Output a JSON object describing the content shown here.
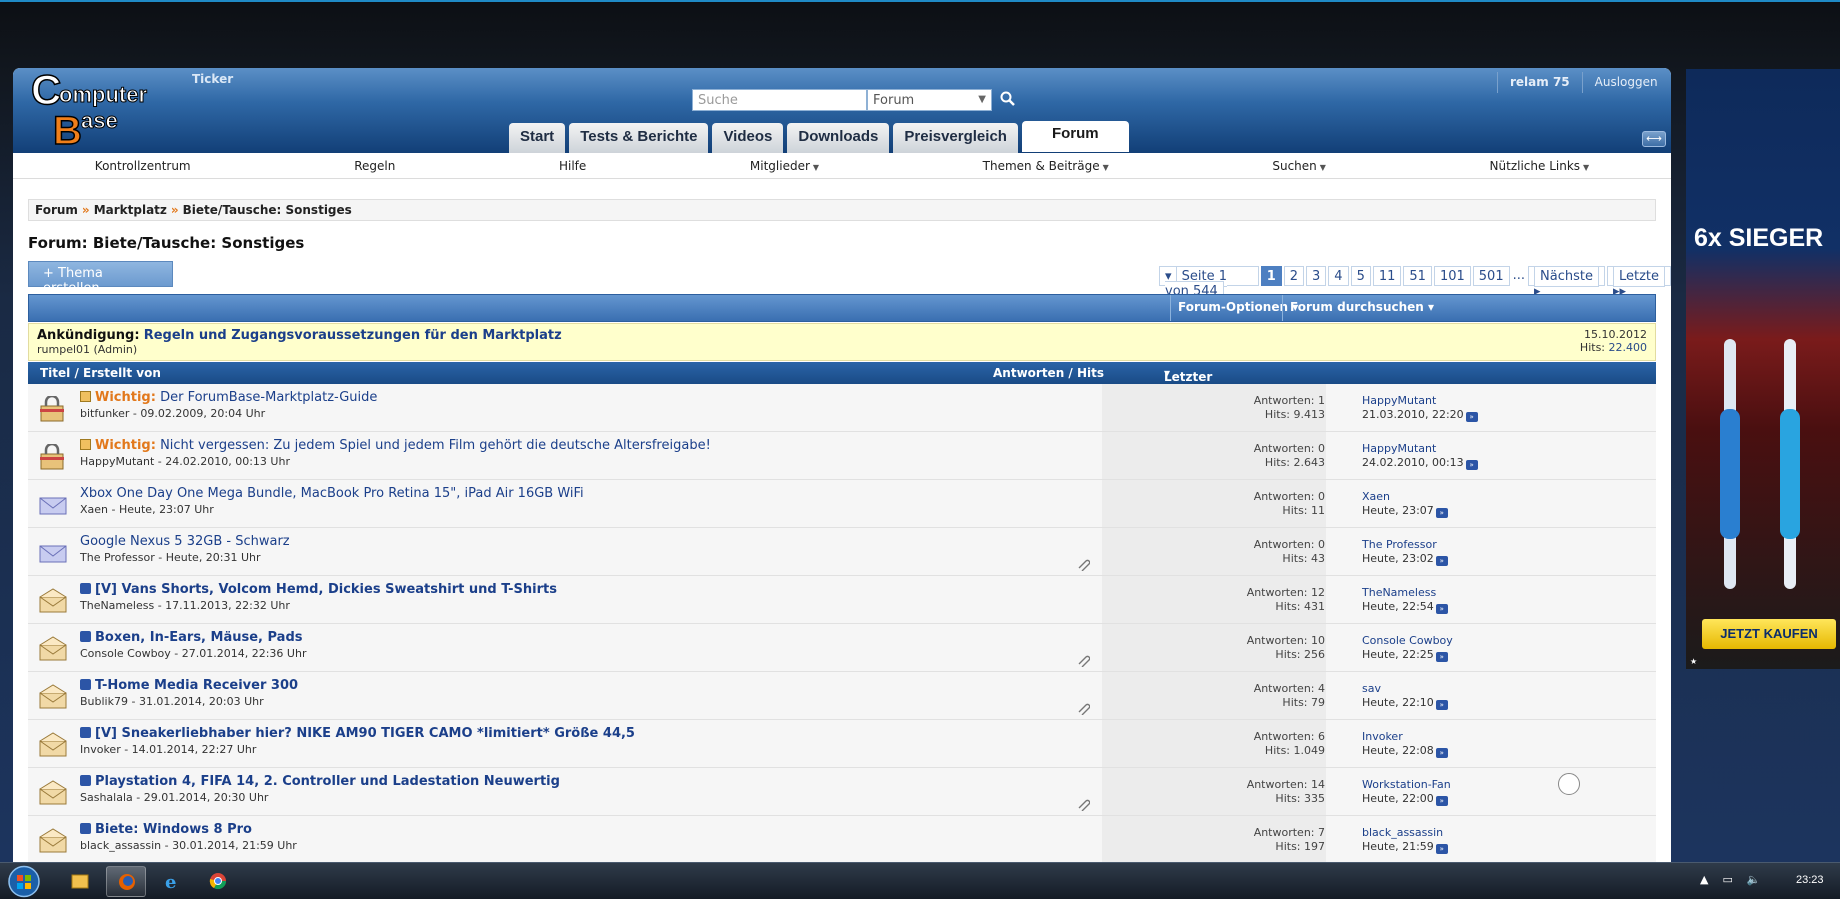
{
  "header": {
    "ticker": "Ticker",
    "search_placeholder": "Suche",
    "search_scope": "Forum",
    "user": "relam 75",
    "logout": "Ausloggen"
  },
  "tabs": [
    {
      "label": "Start"
    },
    {
      "label": "Tests & Berichte"
    },
    {
      "label": "Videos"
    },
    {
      "label": "Downloads"
    },
    {
      "label": "Preisvergleich"
    },
    {
      "label": "Forum"
    }
  ],
  "subnav": [
    {
      "label": "Kontrollzentrum"
    },
    {
      "label": "Regeln"
    },
    {
      "label": "Hilfe"
    },
    {
      "label": "Mitglieder"
    },
    {
      "label": "Themen & Beiträge"
    },
    {
      "label": "Suchen"
    },
    {
      "label": "Nützliche Links"
    }
  ],
  "breadcrumb": [
    "Forum",
    "Marktplatz",
    "Biete/Tausche: Sonstiges"
  ],
  "forum_title": "Forum: Biete/Tausche: Sonstiges",
  "new_thread": "+ Thema erstellen",
  "pager": {
    "label": "Seite 1 von 544",
    "pages": [
      "1",
      "2",
      "3",
      "4",
      "5",
      "11",
      "51",
      "101",
      "501"
    ],
    "dots": "...",
    "next": "Nächste",
    "last": "Letzte"
  },
  "forum_options": "Forum-Optionen",
  "forum_search": "Forum durchsuchen",
  "announcement": {
    "label": "Ankündigung:",
    "title": "Regeln und Zugangsvoraussetzungen für den Marktplatz",
    "author": "rumpel01 (Admin)",
    "date": "15.10.2012",
    "hits_label": "Hits:",
    "hits": "22.400"
  },
  "columns": {
    "title": "Titel / Erstellt von",
    "stats": "Antworten / Hits",
    "last": "Letzter Beitrag von"
  },
  "threads": [
    {
      "sticky": "Wichtig:",
      "title": "Der ForumBase-Marktplatz-Guide",
      "meta": "bitfunker - 09.02.2009, 20:04 Uhr",
      "replies": "Antworten: 1",
      "hits": "Hits: 9.413",
      "last_user": "HappyMutant",
      "last_date": "21.03.2010, 22:20"
    },
    {
      "sticky": "Wichtig:",
      "title": "Nicht vergessen: Zu jedem Spiel und jedem Film gehört die deutsche Altersfreigabe!",
      "meta": "HappyMutant - 24.02.2010, 00:13 Uhr",
      "replies": "Antworten: 0",
      "hits": "Hits: 2.643",
      "last_user": "HappyMutant",
      "last_date": "24.02.2010, 00:13"
    },
    {
      "sticky": "",
      "title": "Xbox One Day One Mega Bundle, MacBook Pro Retina 15\", iPad Air 16GB WiFi",
      "meta": "Xaen - Heute, 23:07 Uhr",
      "replies": "Antworten: 0",
      "hits": "Hits: 11",
      "last_user": "Xaen",
      "last_date": "Heute, 23:07"
    },
    {
      "sticky": "",
      "title": "Google Nexus 5 32GB - Schwarz",
      "meta": "The Professor - Heute, 20:31 Uhr",
      "replies": "Antworten: 0",
      "hits": "Hits: 43",
      "last_user": "The Professor",
      "last_date": "Heute, 23:02"
    },
    {
      "sticky": "",
      "title": "[V] Vans Shorts, Volcom Hemd, Dickies Sweatshirt und T-Shirts",
      "meta": "TheNameless - 17.11.2013, 22:32 Uhr",
      "replies": "Antworten: 12",
      "hits": "Hits: 431",
      "last_user": "TheNameless",
      "last_date": "Heute, 22:54"
    },
    {
      "sticky": "",
      "title": "Boxen, In-Ears, Mäuse, Pads",
      "meta": "Console Cowboy - 27.01.2014, 22:36 Uhr",
      "replies": "Antworten: 10",
      "hits": "Hits: 256",
      "last_user": "Console Cowboy",
      "last_date": "Heute, 22:25"
    },
    {
      "sticky": "",
      "title": "T-Home Media Receiver 300",
      "meta": "Bublik79 - 31.01.2014, 20:03 Uhr",
      "replies": "Antworten: 4",
      "hits": "Hits: 79",
      "last_user": "sav",
      "last_date": "Heute, 22:10"
    },
    {
      "sticky": "",
      "title": "[V] Sneakerliebhaber hier? NIKE AM90 TIGER CAMO *limitiert* Größe 44,5",
      "meta": "Invoker - 14.01.2014, 22:27 Uhr",
      "replies": "Antworten: 6",
      "hits": "Hits: 1.049",
      "last_user": "Invoker",
      "last_date": "Heute, 22:08"
    },
    {
      "sticky": "",
      "title": "Playstation 4, FIFA 14, 2. Controller und Ladestation Neuwertig",
      "meta": "Sashalala - 29.01.2014, 20:30 Uhr",
      "replies": "Antworten: 14",
      "hits": "Hits: 335",
      "last_user": "Workstation-Fan",
      "last_date": "Heute, 22:00"
    },
    {
      "sticky": "",
      "title": "Biete: Windows 8 Pro",
      "meta": "black_assassin - 30.01.2014, 21:59 Uhr",
      "replies": "Antworten: 7",
      "hits": "Hits: 197",
      "last_user": "black_assassin",
      "last_date": "Heute, 21:59"
    }
  ],
  "ad": {
    "slogan": "6x SIEGER",
    "cta": "JETZT KAUFEN"
  },
  "taskbar": {
    "clock": "23:23"
  }
}
